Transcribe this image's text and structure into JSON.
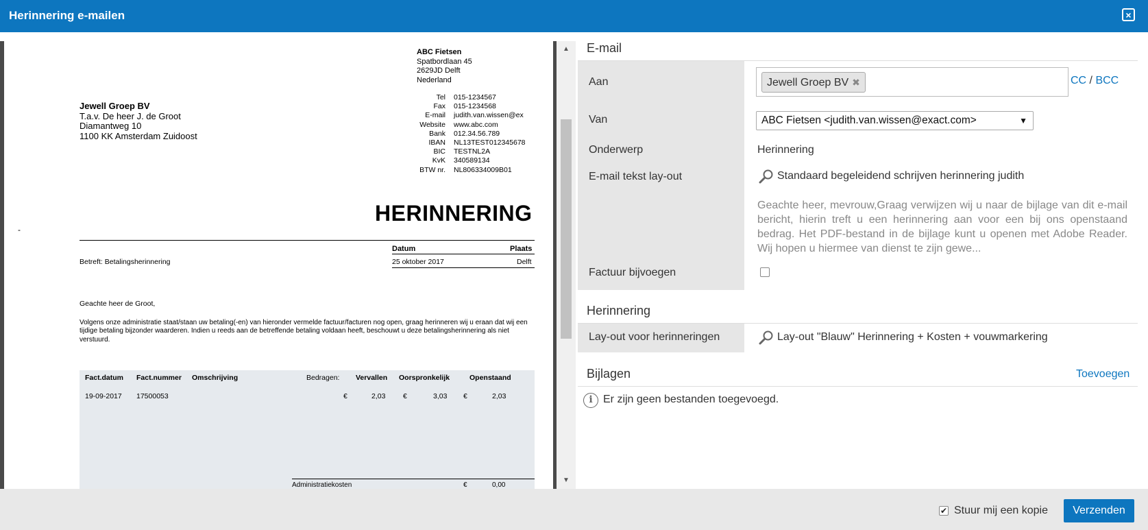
{
  "window": {
    "title": "Herinnering e-mailen",
    "close_icon": "close-icon"
  },
  "document": {
    "company": {
      "name": "ABC Fietsen",
      "street": "Spatbordlaan 45",
      "city": "2629JD Delft",
      "country": "Nederland"
    },
    "contact_rows": [
      {
        "label": "Tel",
        "value": "015-1234567"
      },
      {
        "label": "Fax",
        "value": "015-1234568"
      },
      {
        "label": "E-mail",
        "value": "judith.van.wissen@ex"
      },
      {
        "label": "Website",
        "value": "www.abc.com"
      },
      {
        "label": "Bank",
        "value": "012.34.56.789"
      },
      {
        "label": "IBAN",
        "value": "NL13TEST012345678"
      },
      {
        "label": "BIC",
        "value": "TESTNL2A"
      },
      {
        "label": "KvK",
        "value": "340589134"
      },
      {
        "label": "BTW nr.",
        "value": "NL806334009B01"
      }
    ],
    "recipient": {
      "name": "Jewell Groep BV",
      "attn": "T.a.v. De heer J.  de Groot",
      "street": "Diamantweg 10",
      "city": "1100 KK  Amsterdam Zuidoost"
    },
    "title": "HERINNERING",
    "dash": "-",
    "datum_label": "Datum",
    "plaats_label": "Plaats",
    "betreft": "Betreft: Betalingsherinnering",
    "datum_value": "25 oktober 2017",
    "plaats_value": "Delft",
    "salutation": "Geachte heer  de Groot,",
    "body": "Volgens onze administratie staat/staan uw betaling(-en) van hieronder vermelde factuur/facturen nog open, graag herinneren wij u eraan dat wij een tijdige betaling bijzonder waarderen. Indien u reeds aan de betreffende betaling voldaan heeft, beschouwt u deze betalingsherinnering als niet verstuurd.",
    "table": {
      "headers": [
        "Fact.datum",
        "Fact.nummer",
        "Omschrijving",
        "Bedragen:",
        "Vervallen",
        "Oorspronkelijk",
        "Openstaand"
      ],
      "row": {
        "datum": "19-09-2017",
        "nummer": "17500053",
        "cur1": "€",
        "vervallen": "2,03",
        "cur2": "€",
        "oorspronkelijk": "3,03",
        "cur3": "€",
        "openstaand": "2,03"
      }
    },
    "admin_label": "Administratiekosten",
    "admin_cur": "€",
    "admin_value": "0,00"
  },
  "email": {
    "section_title": "E-mail",
    "aan_label": "Aan",
    "recipient_chip": "Jewell Groep BV",
    "chip_remove": "✖",
    "cc": "CC",
    "cc_sep": " / ",
    "bcc": "BCC",
    "van_label": "Van",
    "van_value": "ABC Fietsen <judith.van.wissen@exact.com>",
    "onderwerp_label": "Onderwerp",
    "onderwerp_value": "Herinnering",
    "layout_label": "E-mail tekst lay-out",
    "layout_link": "Standaard begeleidend schrijven herinnering judith",
    "preview": "Geachte heer, mevrouw,Graag verwijzen wij u naar de bijlage van dit e-mail bericht, hierin treft u een herinnering aan voor een bij ons openstaand bedrag. Het PDF-bestand in de bijlage kunt u openen met Adobe Reader. Wij hopen u hiermee van dienst te zijn gewe...",
    "factuur_label": "Factuur bijvoegen",
    "factuur_checked": false
  },
  "herinnering": {
    "section_title": "Herinnering",
    "layout_label": "Lay-out voor herinneringen",
    "layout_link": "Lay-out \"Blauw\" Herinnering + Kosten + vouwmarkering"
  },
  "bijlagen": {
    "section_title": "Bijlagen",
    "add_link": "Toevoegen",
    "empty_text": "Er zijn geen bestanden toegevoegd."
  },
  "footer": {
    "copy_label": "Stuur mij een kopie",
    "copy_checked": true,
    "send_label": "Verzenden"
  },
  "colors": {
    "header": "#0d76bf",
    "link": "#0d76bf",
    "label_bg": "#e6e6e6"
  }
}
